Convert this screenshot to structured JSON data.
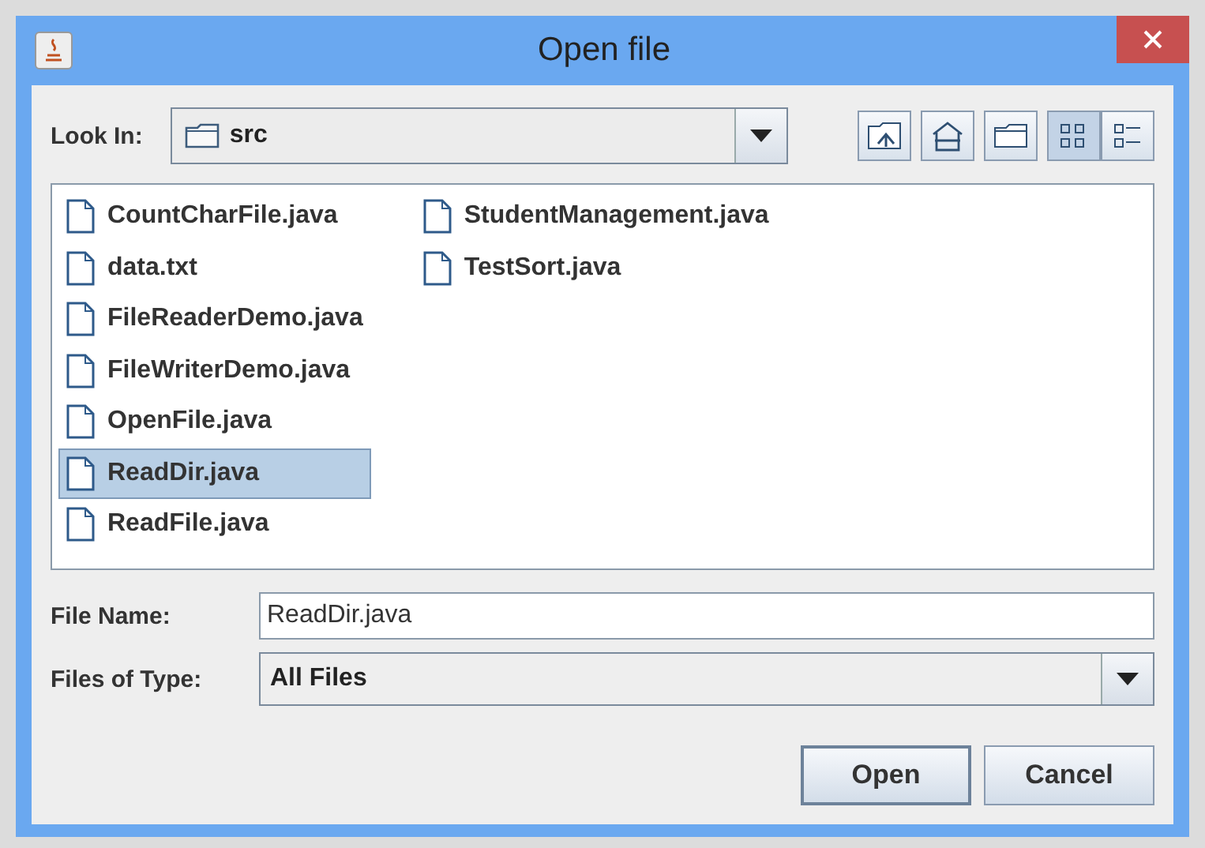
{
  "window": {
    "title": "Open file"
  },
  "look_in": {
    "label": "Look In:",
    "value": "src"
  },
  "toolbar": [
    {
      "kind": "up",
      "selected": false
    },
    {
      "kind": "home",
      "selected": false
    },
    {
      "kind": "new-folder",
      "selected": false
    },
    {
      "kind": "list",
      "selected": true
    },
    {
      "kind": "details",
      "selected": false
    }
  ],
  "files": [
    {
      "name": "CountCharFile.java",
      "selected": false
    },
    {
      "name": "data.txt",
      "selected": false
    },
    {
      "name": "FileReaderDemo.java",
      "selected": false
    },
    {
      "name": "FileWriterDemo.java",
      "selected": false
    },
    {
      "name": "OpenFile.java",
      "selected": false
    },
    {
      "name": "ReadDir.java",
      "selected": true
    },
    {
      "name": "ReadFile.java",
      "selected": false
    },
    {
      "name": "StudentManagement.java",
      "selected": false
    },
    {
      "name": "TestSort.java",
      "selected": false
    }
  ],
  "file_name": {
    "label": "File Name:",
    "value": "ReadDir.java"
  },
  "file_type": {
    "label": "Files of Type:",
    "value": "All Files"
  },
  "buttons": [
    {
      "label": "Open",
      "default": true
    },
    {
      "label": "Cancel",
      "default": false
    }
  ]
}
